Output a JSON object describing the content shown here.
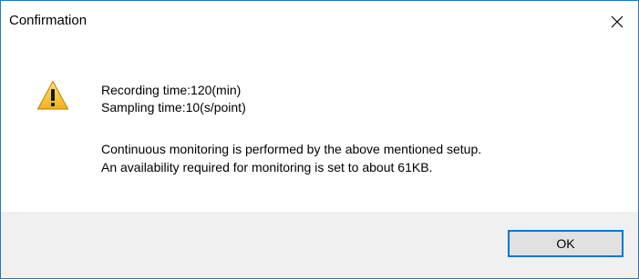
{
  "dialog": {
    "title": "Confirmation",
    "icon": "warning-icon",
    "lines": {
      "recording_time": "Recording time:120(min)",
      "sampling_time": "Sampling time:10(s/point)",
      "continuous_monitoring": "Continuous monitoring is performed by the above mentioned setup.",
      "availability": "An availability required for monitoring is set to about 61KB."
    },
    "ok_label": "OK",
    "close_icon": "close-icon"
  },
  "colors": {
    "border": "#1979ca",
    "footer": "#f0f0f0",
    "button_focus": "#0078d7",
    "button_face": "#e1e1e1",
    "warning_yellow": "#f6c533"
  }
}
